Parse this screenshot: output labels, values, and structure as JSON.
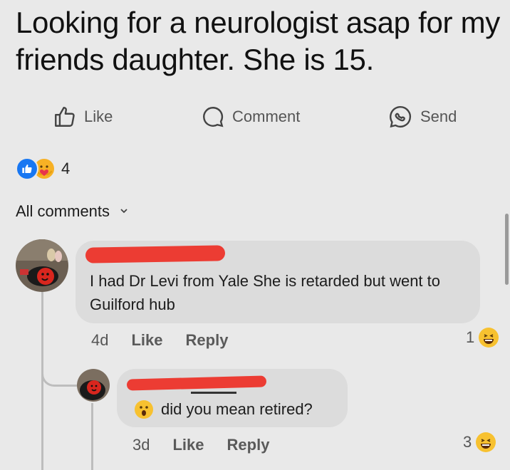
{
  "post": {
    "text": "Looking for a neurologist asap for my friends daughter. She is 15."
  },
  "actions": [
    {
      "label": "Like",
      "icon": "thumbs-up-outline-icon"
    },
    {
      "label": "Comment",
      "icon": "comment-bubble-icon"
    },
    {
      "label": "Send",
      "icon": "messenger-icon"
    }
  ],
  "reactions": {
    "count": "4",
    "types": [
      "like",
      "care"
    ],
    "colors": {
      "like": "#1877f2",
      "care": "#f7b125"
    }
  },
  "comments_filter": {
    "label": "All comments"
  },
  "comments": [
    {
      "author": "",
      "author_redacted": true,
      "text": "I had Dr Levi from Yale She is retarded but went to Guilford  hub",
      "time": "4d",
      "like_label": "Like",
      "reply_label": "Reply",
      "reaction_count": "1",
      "reaction_type": "laughing-emoji-icon"
    },
    {
      "author": "",
      "author_redacted": true,
      "text": "did you mean retired?",
      "leading_emoji": "surprised-face-emoji-icon",
      "time": "3d",
      "like_label": "Like",
      "reply_label": "Reply",
      "reaction_count": "3",
      "reaction_type": "laughing-emoji-icon"
    }
  ],
  "theme": {
    "background": "#e9e9e9",
    "bubble": "#dcdcdc",
    "redaction": "#ec3c33",
    "text": "#1c1c1c",
    "muted": "#555555"
  }
}
